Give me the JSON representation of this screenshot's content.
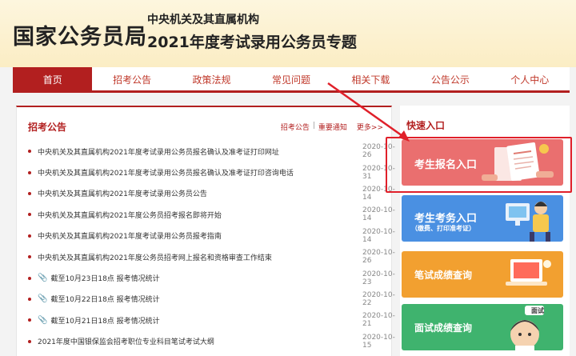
{
  "header": {
    "logo": "国家公务员局",
    "subtitle_line1": "中央机关及其直属机构",
    "subtitle_line2": "2021年度考试录用公务员专题"
  },
  "nav": {
    "items": [
      "首页",
      "招考公告",
      "政策法规",
      "常见问题",
      "相关下载",
      "公告公示",
      "个人中心"
    ],
    "active_index": 0
  },
  "announcements": {
    "title": "招考公告",
    "links": [
      "招考公告",
      "|",
      "重要通知"
    ],
    "more": "更多>>",
    "items": [
      {
        "text": "中央机关及其直属机构2021年度考试录用公务员报名确认及准考证打印网址",
        "date": "2020-10-26",
        "icon": "bullet"
      },
      {
        "text": "中央机关及其直属机构2021年度考试录用公务员报名确认及准考证打印咨询电话",
        "date": "2020-10-31",
        "icon": "bullet"
      },
      {
        "text": "中央机关及其直属机构2021年度考试录用公务员公告",
        "date": "2020-10-14",
        "icon": "bullet"
      },
      {
        "text": "中央机关及其直属机构2021年度公务员招考报名即将开始",
        "date": "2020-10-14",
        "icon": "bullet"
      },
      {
        "text": "中央机关及其直属机构2021年度考试录用公务员报考指南",
        "date": "2020-10-14",
        "icon": "bullet"
      },
      {
        "text": "中央机关及其直属机构2021年度公务员招考网上报名和资格审查工作结束",
        "date": "2020-10-26",
        "icon": "bullet"
      },
      {
        "text": "截至10月23日18点 报考情况统计",
        "date": "2020-10-23",
        "icon": "paperclip"
      },
      {
        "text": "截至10月22日18点 报考情况统计",
        "date": "2020-10-22",
        "icon": "paperclip"
      },
      {
        "text": "截至10月21日18点 报考情况统计",
        "date": "2020-10-21",
        "icon": "paperclip"
      },
      {
        "text": "2021年度中国银保监会招考职位专业科目笔试考试大纲",
        "date": "2020-10-15",
        "icon": "bullet"
      }
    ]
  },
  "quick_entry": {
    "title": "快速入口",
    "cards": [
      {
        "label": "考生报名入口",
        "color": "#ea6f6f"
      },
      {
        "label": "考生考务入口",
        "sub": "（缴费、打印准考证）",
        "color": "#4a90e2"
      },
      {
        "label": "笔试成绩查询",
        "color": "#f2a030"
      },
      {
        "label": "面试成绩查询",
        "color": "#3fb36e",
        "badge": "面试"
      }
    ]
  },
  "colors": {
    "accent": "#b21f1f",
    "highlight": "#e0202a"
  }
}
